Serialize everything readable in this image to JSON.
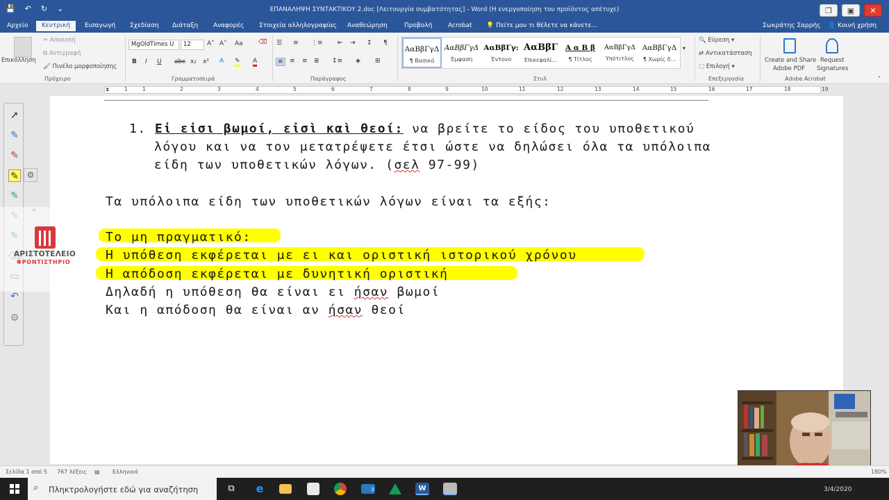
{
  "titlebar": {
    "title": "ΕΠΑΝΑΛΗΨΗ ΣΥΝΤΑΚΤΙΚΟΥ 2.doc [Λειτουργία συμβατότητας] - Word (Η ενεργοποίηση του προϊόντος απέτυχε)",
    "qat_save": "💾",
    "qat_undo": "↶",
    "qat_redo": "↻",
    "qat_more": "⌄",
    "btn_restore": "❐",
    "btn_cam": "▣",
    "btn_close": "✕"
  },
  "tabs": {
    "file": "Αρχείο",
    "home": "Κεντρική",
    "insert": "Εισαγωγή",
    "design": "Σχεδίαση",
    "layout": "Διάταξη",
    "references": "Αναφορές",
    "mailings": "Στοιχεία αλληλογραφίας",
    "review": "Αναθεώρηση",
    "view": "Προβολή",
    "acrobat": "Acrobat",
    "tellme": "Πείτε μου τι θέλετε να κάνετε...",
    "user": "Σωκράτης Σαρρής",
    "share": "Κοινή χρήση"
  },
  "ribbon": {
    "paste": "Επικόλληση",
    "cut": "Αποκοπή",
    "copy": "Αντιγραφή",
    "format_painter": "Πινέλο μορφοποίησης",
    "font_name": "MgOldTimes U",
    "font_size": "12",
    "groups": {
      "clipboard": "Πρόχειρο",
      "font": "Γραμματοσειρά",
      "paragraph": "Παράγραφος",
      "styles": "Στυλ",
      "editing": "Επεξεργασία",
      "acrobat": "Adobe Acrobat"
    },
    "styles": [
      {
        "sample": "ΑαΒβΓγΔ",
        "name": "¶ Βασικό"
      },
      {
        "sample": "ΑαΒβΓγΔ",
        "name": "Έμφαση"
      },
      {
        "sample": "ΑαΒβΓγ:",
        "name": "Έντονο"
      },
      {
        "sample": "ΑαΒβΓ",
        "name": "Επικεφαλί..."
      },
      {
        "sample": "Α α Β β",
        "name": "¶ Τίτλος"
      },
      {
        "sample": "ΑαΒβΓγΔ",
        "name": "Υπότιτλος"
      },
      {
        "sample": "ΑαΒβΓγΔ",
        "name": "¶ Χωρίς δ..."
      }
    ],
    "find": "Εύρεση",
    "replace": "Αντικατάσταση",
    "select": "Επιλογή",
    "create_share_1": "Create and Share",
    "create_share_2": "Adobe PDF",
    "request_1": "Request",
    "request_2": "Signatures",
    "bold": "B",
    "italic": "I",
    "underline": "U"
  },
  "ruler": {
    "numbers": [
      "1",
      "1",
      "2",
      "3",
      "4",
      "5",
      "6",
      "7",
      "8",
      "9",
      "10",
      "11",
      "12",
      "13",
      "14",
      "15",
      "16",
      "17",
      "18",
      "19"
    ]
  },
  "document": {
    "item_number": "1.",
    "item_title": "Εἰ εἰσι βωμοί, εἰσὶ καὶ θεοί:",
    "item_line1_rest": " να βρείτε το είδος του υποθετικού",
    "item_line2": "λόγου και να τον μετατρέψετε έτσι ώστε να δηλώσει όλα τα υπόλοιπα",
    "item_line3": "είδη των υποθετικών λόγων. (",
    "item_line3_sel": "σελ",
    "item_line3_end": " 97-99)",
    "remaining": "Τα υπόλοιπα είδη των υποθετικών λόγων είναι τα εξής:",
    "hl1": "Το μη πραγματικό:",
    "hl2": "Η υπόθεση εκφέρεται με ει και οριστική ιστορικού χρόνου",
    "hl3": "Η απόδοση εκφέρεται με δυνητική οριστική",
    "line4_a": "Δηλαδή η υπόθεση θα είναι ει ",
    "line4_b": "ήσαν",
    "line4_c": " βωμοί",
    "line5_a": " Και η απόδοση θα είναι αν ",
    "line5_b": "ήσαν",
    "line5_c": " θεοί"
  },
  "logo": {
    "name": "ΑΡΙΣΤΟΤΕΛΕΙΟ",
    "sub": "ΦΡΟΝΤΙΣΤΗΡΙΟ"
  },
  "status": {
    "page": "Σελίδα 1 από 5",
    "words": "767 λέξεις",
    "lang": "Ελληνικά",
    "zoom": "180%"
  },
  "taskbar": {
    "search_placeholder": "Πληκτρολογήστε εδώ για αναζήτηση",
    "date": "3/4/2020",
    "mail_badge": "3"
  },
  "colors": {
    "word_blue": "#2b579a",
    "highlight": "#ffff00"
  }
}
